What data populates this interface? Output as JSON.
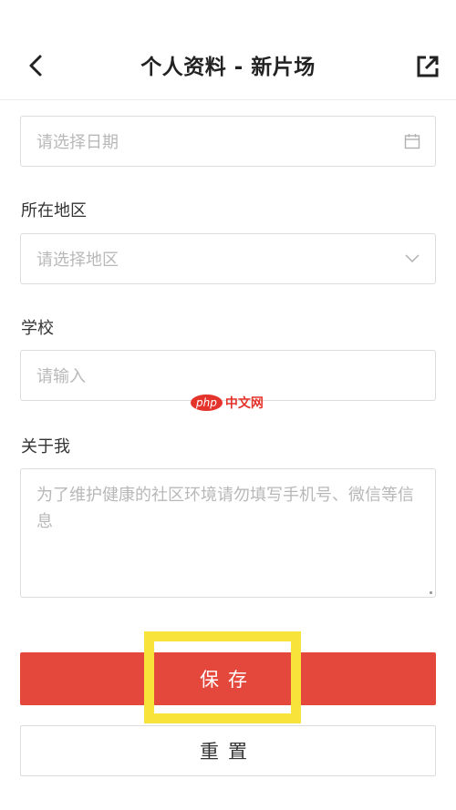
{
  "header": {
    "title": "个人资料 - 新片场",
    "back_icon": "chevron-left-icon",
    "share_icon": "external-link-icon"
  },
  "form": {
    "date": {
      "placeholder": "请选择日期",
      "icon": "calendar-icon"
    },
    "region": {
      "label": "所在地区",
      "placeholder": "请选择地区",
      "icon": "chevron-down-icon"
    },
    "school": {
      "label": "学校",
      "placeholder": "请输入"
    },
    "about": {
      "label": "关于我",
      "placeholder": "为了维护健康的社区环境请勿填写手机号、微信等信息"
    }
  },
  "actions": {
    "save_label": "保存",
    "reset_label": "重置"
  },
  "watermark": {
    "badge": "php",
    "text": "中文网"
  },
  "colors": {
    "primary": "#e4473c",
    "highlight": "#f7e33a",
    "placeholder": "#b8b8b8",
    "border": "#dcdcdc"
  }
}
